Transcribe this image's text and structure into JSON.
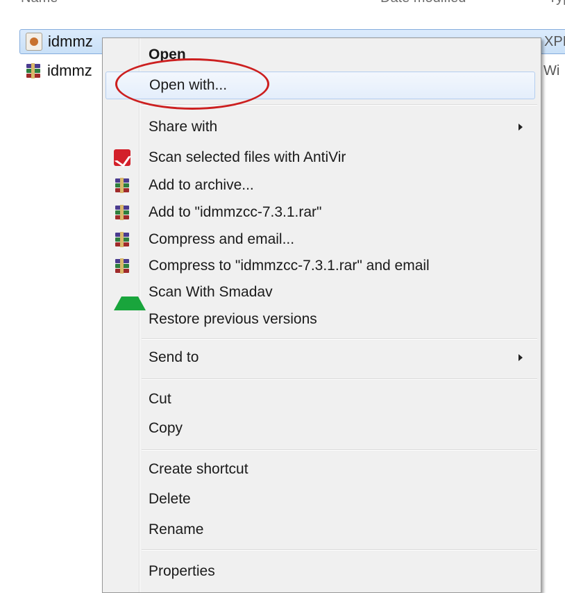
{
  "explorer": {
    "columns": {
      "name": "Name",
      "date": "Date modified",
      "type": "Typ"
    },
    "files": [
      {
        "name": "idmmz",
        "type": "XPI",
        "icon": "xpi-file-icon",
        "selected": true
      },
      {
        "name": "idmmz",
        "type": "Wi",
        "icon": "winrar-archive-icon",
        "selected": false
      }
    ]
  },
  "context_menu": {
    "open": "Open",
    "open_with": "Open with...",
    "share_with": "Share with",
    "scan_antivir": "Scan selected files with AntiVir",
    "add_to_archive": "Add to archive...",
    "add_to_rar": "Add to \"idmmzcc-7.3.1.rar\"",
    "compress_email": "Compress and email...",
    "compress_to_rar_email": "Compress to \"idmmzcc-7.3.1.rar\" and email",
    "scan_smadav": "Scan With Smadav",
    "restore_versions": "Restore previous versions",
    "send_to": "Send to",
    "cut": "Cut",
    "copy": "Copy",
    "create_shortcut": "Create shortcut",
    "delete": "Delete",
    "rename": "Rename",
    "properties": "Properties",
    "highlight_color": "#cc1f1f"
  }
}
